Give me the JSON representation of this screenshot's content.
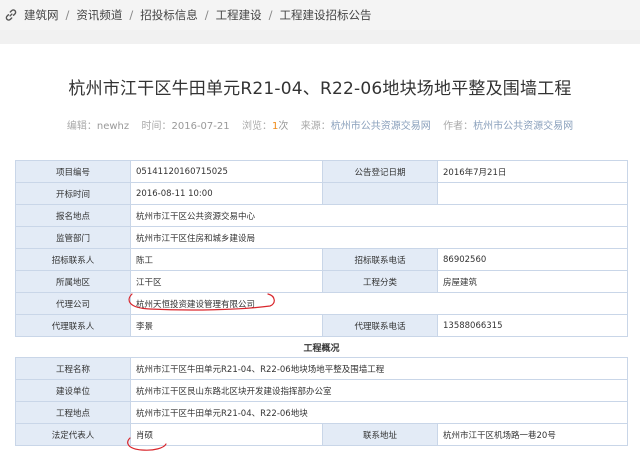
{
  "breadcrumb": {
    "items": [
      "建筑网",
      "资讯频道",
      "招投标信息",
      "工程建设",
      "工程建设招标公告"
    ],
    "separator": "/"
  },
  "article": {
    "title": "杭州市江干区牛田单元R21-04、R22-06地块场地平整及围墙工程",
    "meta": {
      "editor_label": "编辑：",
      "editor": "newhz",
      "time_label": "时间：",
      "time": "2016-07-21",
      "views_label": "浏览：",
      "views": "1",
      "views_unit": "次",
      "source_label": "来源：",
      "source": "杭州市公共资源交易网",
      "author_label": "作者：",
      "author": "杭州市公共资源交易网"
    }
  },
  "table": {
    "project_no_label": "项目编号",
    "project_no": "05141120160715025",
    "announce_date_label": "公告登记日期",
    "announce_date": "2016年7月21日",
    "bid_open_label": "开标时间",
    "bid_open": "2016-08-11 10:00",
    "register_place_label": "报名地点",
    "register_place": "杭州市江干区公共资源交易中心",
    "supervisor_label": "监管部门",
    "supervisor": "杭州市江干区住房和城乡建设局",
    "contact_label": "招标联系人",
    "contact": "陈工",
    "contact_phone_label": "招标联系电话",
    "contact_phone": "86902560",
    "region_label": "所属地区",
    "region": "江干区",
    "category_label": "工程分类",
    "category": "房屋建筑",
    "agent_label": "代理公司",
    "agent": "杭州天恒投资建设管理有限公司",
    "agent_contact_label": "代理联系人",
    "agent_contact": "李景",
    "agent_phone_label": "代理联系电话",
    "agent_phone": "13588066315",
    "section_title": "工程概况",
    "project_name_label": "工程名称",
    "project_name": "杭州市江干区牛田单元R21-04、R22-06地块场地平整及围墙工程",
    "builder_label": "建设单位",
    "builder": "杭州市江干区艮山东路北区块开发建设指挥部办公室",
    "location_label": "工程地点",
    "location": "杭州市江干区牛田单元R21-04、R22-06地块",
    "legal_rep_label": "法定代表人",
    "legal_rep": "肖硕",
    "address_label": "联系地址",
    "address": "杭州市江干区机场路一巷20号"
  },
  "colors": {
    "label_bg": "#e3ebf6",
    "border": "#c9d6e8",
    "annotation": "#d9262c",
    "views_highlight": "#f08a17"
  }
}
